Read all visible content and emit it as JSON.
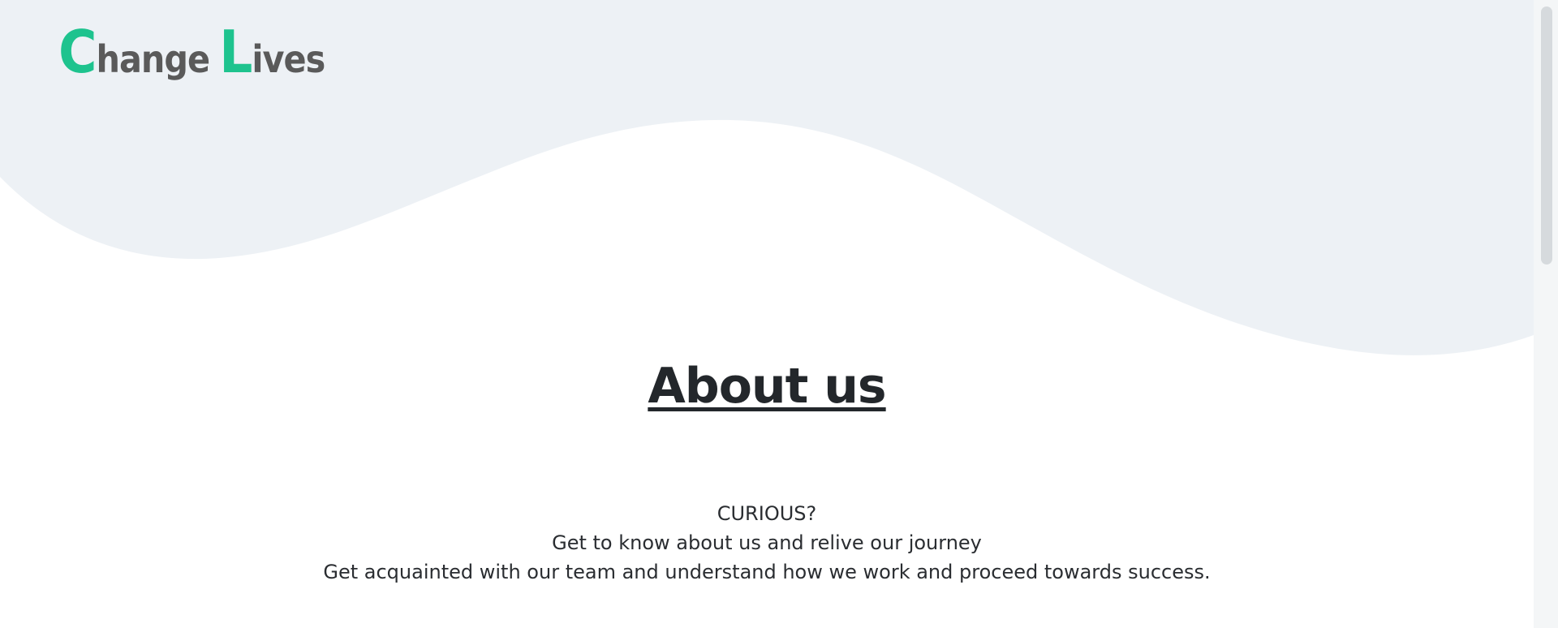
{
  "brand": {
    "logo_first_initial": "C",
    "logo_first_rest": "hange",
    "logo_second_initial": "L",
    "logo_second_rest": "ives"
  },
  "main": {
    "heading": "About us",
    "intro_lines": [
      "CURIOUS?",
      "Get to know about us and relive our journey",
      "Get acquainted with our team and understand how we work and proceed towards success."
    ]
  },
  "colors": {
    "accent": "#1ec38e",
    "logo_text": "#5a5a5a",
    "wave_background": "#edf1f5",
    "heading_text": "#23272b",
    "body_text": "#2a2d31",
    "page_background": "#ffffff"
  }
}
